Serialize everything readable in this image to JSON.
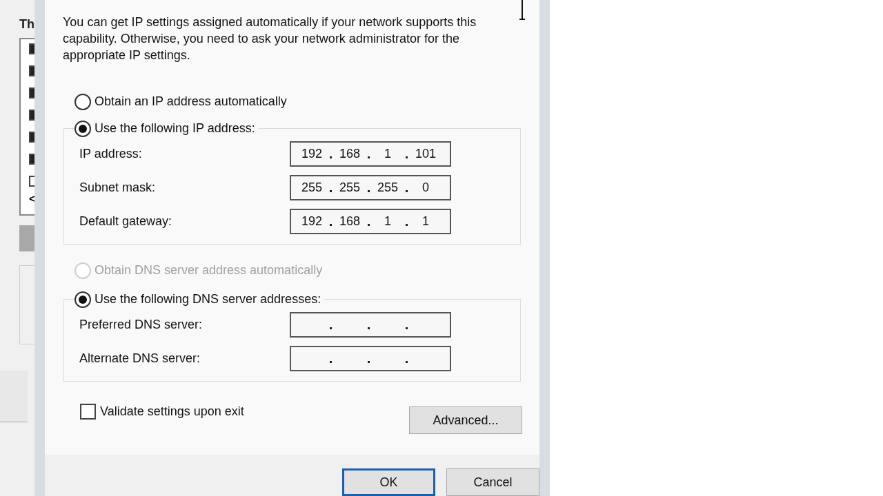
{
  "background_window": {
    "label": "Th",
    "checkboxes": [
      {
        "checked": true
      },
      {
        "checked": true
      },
      {
        "checked": true
      },
      {
        "checked": true
      },
      {
        "checked": true
      },
      {
        "checked": true
      },
      {
        "checked": false
      }
    ],
    "scroll_arrow": "<"
  },
  "dialog": {
    "description": "You can get IP settings assigned automatically if your network supports this capability. Otherwise, you need to ask your network administrator for the appropriate IP settings.",
    "ip_options": [
      {
        "label": "Obtain an IP address automatically",
        "selected": false,
        "disabled": false
      },
      {
        "label": "Use the following IP address:",
        "selected": true,
        "disabled": false
      }
    ],
    "ip_fields": [
      {
        "label": "IP address:",
        "octets": [
          "192",
          "168",
          "1",
          "101"
        ]
      },
      {
        "label": "Subnet mask:",
        "octets": [
          "255",
          "255",
          "255",
          "0"
        ]
      },
      {
        "label": "Default gateway:",
        "octets": [
          "192",
          "168",
          "1",
          "1"
        ]
      }
    ],
    "dns_options": [
      {
        "label": "Obtain DNS server address automatically",
        "selected": false,
        "disabled": true
      },
      {
        "label": "Use the following DNS server addresses:",
        "selected": true,
        "disabled": false
      }
    ],
    "dns_fields": [
      {
        "label": "Preferred DNS server:"
      },
      {
        "label": "Alternate DNS server:"
      }
    ],
    "validate": {
      "label": "Validate settings upon exit",
      "checked": false
    },
    "advanced_button": "Advanced...",
    "buttons": [
      {
        "label": "OK",
        "default": true
      },
      {
        "label": "Cancel",
        "default": false
      }
    ]
  }
}
